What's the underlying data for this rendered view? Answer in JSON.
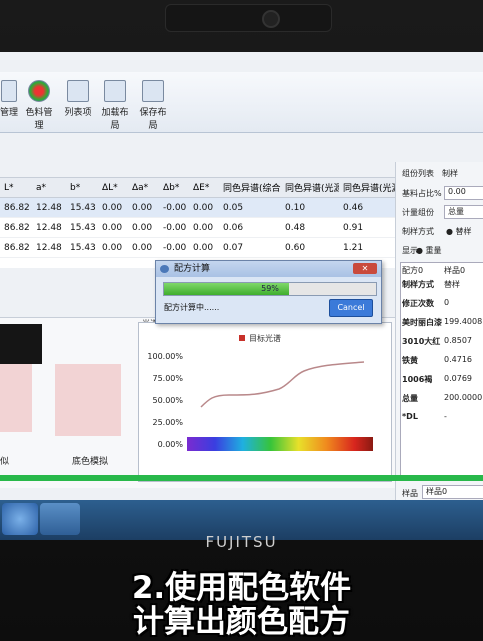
{
  "toolbar": {
    "items": [
      {
        "label": "管理"
      },
      {
        "label": "色料管理"
      },
      {
        "label": "列表项"
      },
      {
        "label": "加载布局"
      },
      {
        "label": "保存布局"
      }
    ]
  },
  "grid": {
    "headers": [
      "L*",
      "a*",
      "b*",
      "ΔL*",
      "Δa*",
      "Δb*",
      "ΔE*",
      "同色异谱(综合)",
      "同色异谱(光源1)",
      "同色异谱(光源"
    ],
    "rows": [
      [
        "86.82",
        "12.48",
        "15.43",
        "0.00",
        "0.00",
        "-0.00",
        "0.00",
        "0.05",
        "0.10",
        "0.46"
      ],
      [
        "86.82",
        "12.48",
        "15.43",
        "0.00",
        "0.00",
        "-0.00",
        "0.00",
        "0.06",
        "0.48",
        "0.91"
      ],
      [
        "86.82",
        "12.48",
        "15.43",
        "0.00",
        "0.00",
        "-0.00",
        "0.00",
        "0.07",
        "0.60",
        "1.21"
      ]
    ]
  },
  "right_panel": {
    "tabs": [
      "组份列表",
      "制样"
    ],
    "base_ratio_label": "基料占比%",
    "base_ratio_value": "0.00",
    "calc_unit_label": "计量组份",
    "calc_unit_value": "总量",
    "method_label": "制样方式",
    "method_value": "替样",
    "display_label": "显示",
    "display_value": "重量",
    "table_head": [
      "配方0",
      "样品0"
    ],
    "rows": [
      {
        "label": "制样方式",
        "value": "替样"
      },
      {
        "label": "修正次数",
        "value": "0"
      },
      {
        "label": "美时丽白漆",
        "value": "199.4008"
      },
      {
        "label": "3010大红",
        "value": "0.8507"
      },
      {
        "label": "铁黄",
        "value": "0.4716"
      },
      {
        "label": "1006褐",
        "value": "0.0769"
      },
      {
        "label": "总量",
        "value": "200.0000"
      },
      {
        "label": "*DL",
        "value": "-"
      }
    ],
    "bottom_tabs": [
      "样品",
      "样品0"
    ]
  },
  "lower": {
    "spectrum_label": "光谱",
    "legend": "目标光谱",
    "y_ticks": [
      "100.00%",
      "75.00%",
      "50.00%",
      "25.00%",
      "0.00%"
    ],
    "left_label": "似",
    "swatch_label": "底色模拟"
  },
  "dialog": {
    "title": "配方计算",
    "progress_text": "59%",
    "progress": 0.59,
    "status": "配方计算中......",
    "cancel_label": "Cancel"
  },
  "brand": "FUJITSU",
  "caption": {
    "line1": "2.使用配色软件",
    "line2": "计算出颜色配方"
  }
}
